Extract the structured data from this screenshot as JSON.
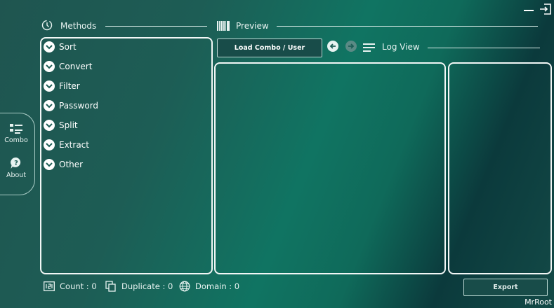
{
  "window": {
    "brand": "MrRoot"
  },
  "sidebar": {
    "items": [
      {
        "label": "Combo",
        "icon": "list-icon"
      },
      {
        "label": "About",
        "icon": "help-bubble-icon"
      }
    ]
  },
  "methods": {
    "title": "Methods",
    "icon": "clock-icon",
    "items": [
      {
        "label": "Sort"
      },
      {
        "label": "Convert"
      },
      {
        "label": "Filter"
      },
      {
        "label": "Password"
      },
      {
        "label": "Split"
      },
      {
        "label": "Extract"
      },
      {
        "label": "Other"
      }
    ]
  },
  "preview": {
    "title": "Preview",
    "load_button": "Load Combo / User",
    "log_view_label": "Log View"
  },
  "stats": {
    "count": "Count : 0",
    "duplicate": "Duplicate : 0",
    "domain": "Domain : 0"
  },
  "export": {
    "label": "Export"
  },
  "colors": {
    "panel_border": "#f2f7f6",
    "accent": "#107462",
    "background_dark": "#1f5550"
  }
}
